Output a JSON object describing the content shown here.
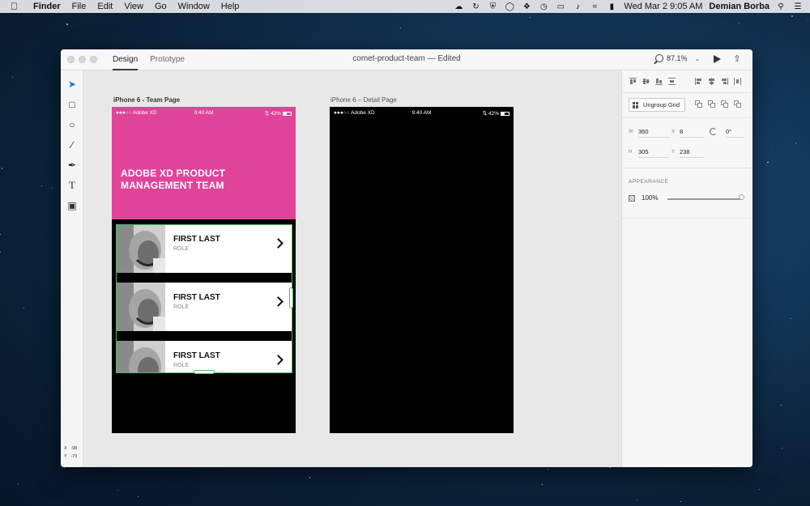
{
  "menubar": {
    "apple_icon": "apple-logo",
    "items": [
      "Finder",
      "File",
      "Edit",
      "View",
      "Go",
      "Window",
      "Help"
    ],
    "clock": "Wed Mar 2  9:05 AM",
    "user": "Demian Borba"
  },
  "window": {
    "tabs": [
      "Design",
      "Prototype"
    ],
    "active_tab": "Design",
    "doc_title": "comet-product-team — Edited",
    "zoom": "87.1%"
  },
  "canvas": {
    "artboards": [
      {
        "label": "iPhone 6 - Team Page",
        "status_carrier": "●●●○○ Adobe XD",
        "status_time": "9:40 AM",
        "status_battery": "42%",
        "hero_title": "ADOBE XD PRODUCT MANAGEMENT TEAM",
        "hero_color": "#e0449a",
        "cards": [
          {
            "name": "FIRST LAST",
            "role": "ROLE"
          },
          {
            "name": "FIRST LAST",
            "role": "ROLE"
          },
          {
            "name": "FIRST LAST",
            "role": "ROLE"
          }
        ]
      },
      {
        "label": "iPhone 6 – Detail Page",
        "status_carrier": "●●●○○ Adobe XD",
        "status_time": "9:40 AM",
        "status_battery": "42%"
      }
    ],
    "selection_color": "#4cb869",
    "cursor": {
      "x_label": "X",
      "x": "-98",
      "y_label": "Y",
      "y": "-73"
    }
  },
  "inspector": {
    "ungroup_label": "Ungroup Grid",
    "w_label": "W",
    "w": "360",
    "x_label": "X",
    "x": "8",
    "rotation": "0°",
    "h_label": "H",
    "h": "305",
    "y_label": "Y",
    "y": "238",
    "appearance_title": "APPEARANCE",
    "opacity": "100%",
    "opacity_fraction": 1.0
  }
}
